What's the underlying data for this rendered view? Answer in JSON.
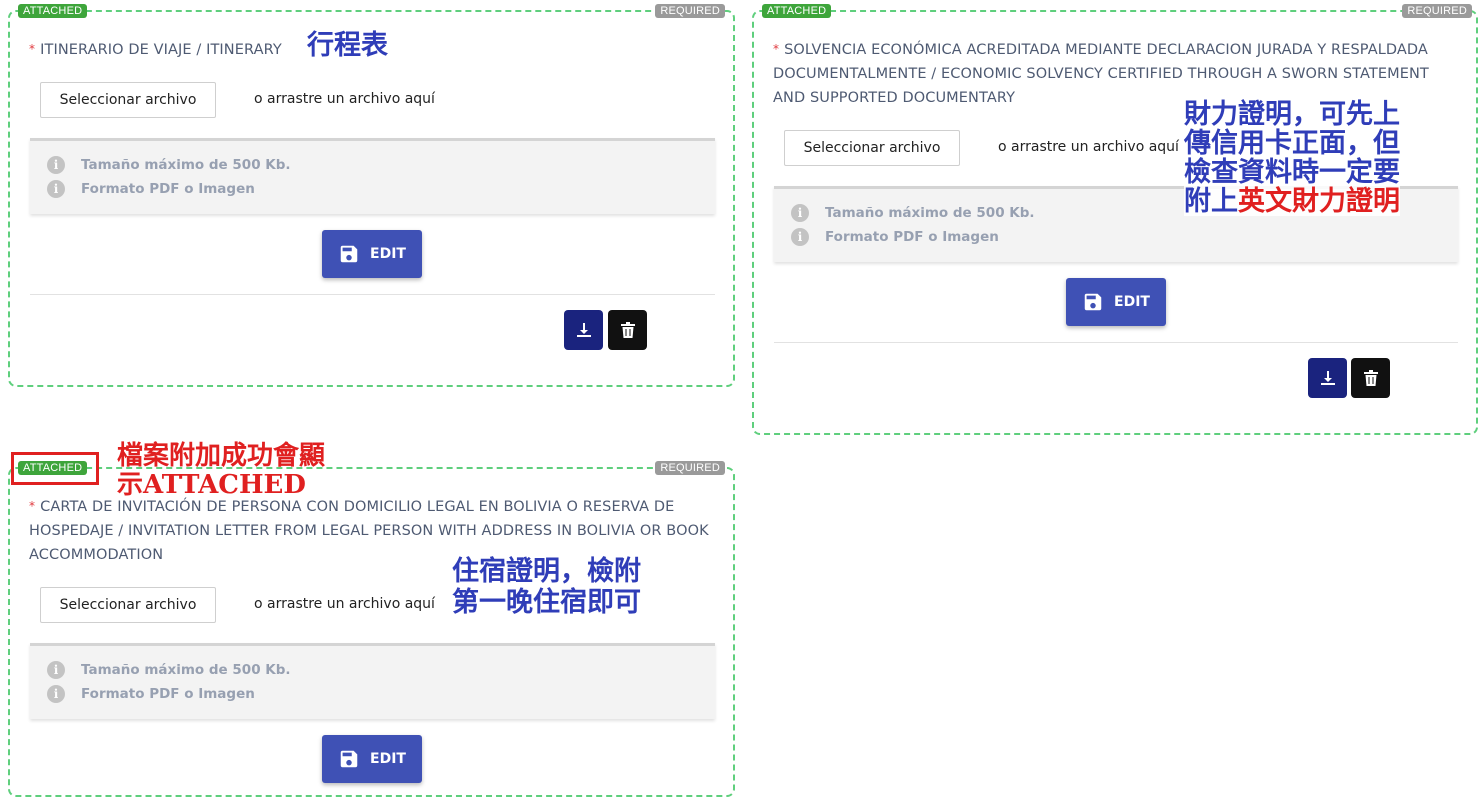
{
  "cards": [
    {
      "status_tag": "ATTACHED",
      "required_tag": "REQUIRED",
      "required_mark": "*",
      "title": "ITINERARIO DE VIAJE / ITINERARY",
      "select_label": "Seleccionar archivo",
      "drag_text": "o arrastre un archivo aquí",
      "info_size": "Tamaño máximo de 500 Kb.",
      "info_format": "Formato PDF o Imagen",
      "edit_label": "EDIT"
    },
    {
      "status_tag": "ATTACHED",
      "required_tag": "REQUIRED",
      "required_mark": "*",
      "title": "SOLVENCIA ECONÓMICA ACREDITADA MEDIANTE DECLARACION JURADA Y RESPALDADA DOCUMENTALMENTE / ECONOMIC SOLVENCY CERTIFIED THROUGH A SWORN STATEMENT AND SUPPORTED DOCUMENTARY",
      "select_label": "Seleccionar archivo",
      "drag_text": "o arrastre un archivo aquí",
      "info_size": "Tamaño máximo de 500 Kb.",
      "info_format": "Formato PDF o Imagen",
      "edit_label": "EDIT"
    },
    {
      "status_tag": "ATTACHED",
      "required_tag": "REQUIRED",
      "required_mark": "*",
      "title": "CARTA DE INVITACIÓN DE PERSONA CON DOMICILIO LEGAL EN BOLIVIA O RESERVA DE HOSPEDAJE / INVITATION LETTER FROM LEGAL PERSON WITH ADDRESS IN BOLIVIA OR BOOK ACCOMMODATION",
      "select_label": "Seleccionar archivo",
      "drag_text": "o arrastre un archivo aquí",
      "info_size": "Tamaño máximo de 500 Kb.",
      "info_format": "Formato PDF o Imagen",
      "edit_label": "EDIT"
    }
  ],
  "annotations": {
    "itinerary": "行程表",
    "financial_line1": "財力證明，可先上",
    "financial_line2": "傳信用卡正面，但",
    "financial_line3": "檢查資料時一定要",
    "financial_line4_prefix": "附上",
    "financial_line4_highlight": "英文財力證明",
    "attached_line1": "檔案附加成功會顯",
    "attached_line2": "示ATTACHED",
    "lodging_line1": "住宿證明，檢附",
    "lodging_line2": "第一晚住宿即可"
  },
  "icons": {
    "info": "info-icon",
    "save": "save-icon",
    "download": "download-icon",
    "delete": "trash-icon"
  },
  "colors": {
    "attached_green": "#3ea53b",
    "required_gray": "#9a9a9a",
    "dashed_border": "#5fcf7d",
    "edit_blue": "#3f51b5",
    "download_navy": "#1a237e",
    "annotation_blue": "#2f3db8",
    "annotation_red": "#e02020"
  }
}
